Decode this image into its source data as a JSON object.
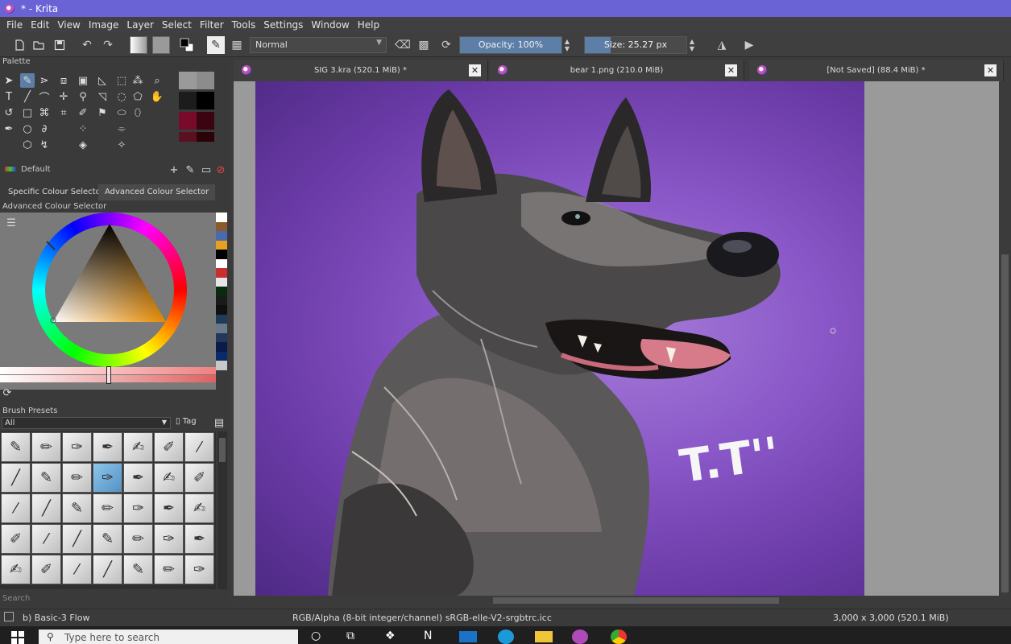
{
  "window": {
    "title": "* - Krita"
  },
  "menu": [
    "File",
    "Edit",
    "View",
    "Image",
    "Layer",
    "Select",
    "Filter",
    "Tools",
    "Settings",
    "Window",
    "Help"
  ],
  "toolbar": {
    "blend_mode": "Normal",
    "opacity_label": "Opacity: 100%",
    "opacity_fraction": 1.0,
    "size_label": "Size: 25.27 px",
    "size_fraction": 0.25
  },
  "left_dock": {
    "palette_title": "Palette",
    "palette_name": "Default",
    "palette_colors": [
      "#9a9a9a",
      "#8c8c8c",
      "#1c1c1c",
      "#000000",
      "#7a0a2a",
      "#3a0410",
      "#5a1020",
      "#2a0208"
    ],
    "color_tabs": [
      "Specific Colour Selector",
      "Advanced Colour Selector"
    ],
    "advanced_selector_title": "Advanced Colour Selector",
    "ramp_colors": [
      "#ffffff",
      "#8a5a2a",
      "#4a6ab0",
      "#e8a020",
      "#000000",
      "#ffffff",
      "#c83030",
      "#e6e6e6",
      "#0a2a10",
      "#1a1a1a",
      "#101010",
      "#203a5a",
      "#6a7a8a",
      "#24365a",
      "#0a1a4a",
      "#0a2a6a",
      "#c8c8c8"
    ],
    "brush_presets_title": "Brush Presets",
    "brush_filter": "All",
    "tag_label": "Tag",
    "search_placeholder": "Search"
  },
  "documents": [
    {
      "label": "SIG 3.kra (520.1 MiB) *"
    },
    {
      "label": "bear 1.png (210.0 MiB)"
    },
    {
      "label": "[Not Saved]  (88.4 MiB) *"
    }
  ],
  "canvas": {
    "signature_text": "T.T''"
  },
  "status": {
    "brush": "b) Basic-3 Flow",
    "color_space": "RGB/Alpha (8-bit integer/channel)  sRGB-elle-V2-srgbtrc.icc",
    "dims": "3,000 x 3,000 (520.1 MiB)"
  },
  "taskbar": {
    "search_placeholder": "Type here to search"
  }
}
